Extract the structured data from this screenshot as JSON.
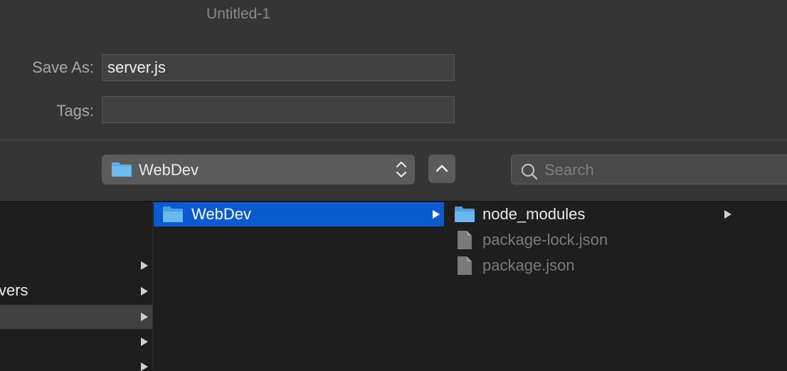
{
  "window": {
    "title": "Untitled-1"
  },
  "form": {
    "save_as_label": "Save As:",
    "save_as_value": "server.js",
    "tags_label": "Tags:",
    "tags_value": ""
  },
  "location": {
    "current_folder": "WebDev",
    "search_placeholder": "Search"
  },
  "columns": {
    "first": {
      "partial_item": "vers"
    },
    "second": {
      "selected_folder": "WebDev"
    },
    "third": [
      {
        "name": "node_modules",
        "type": "folder",
        "enabled": true
      },
      {
        "name": "package-lock.json",
        "type": "file",
        "enabled": false
      },
      {
        "name": "package.json",
        "type": "file",
        "enabled": false
      }
    ]
  },
  "colors": {
    "selection": "#0a5bd0",
    "folder": "#56a8e8",
    "background": "#1e1e1f",
    "panel": "#353535"
  },
  "icons": [
    "folder-icon",
    "file-icon",
    "search-icon",
    "chevron-up-icon",
    "updown-chevron-icon",
    "disclosure-arrow-icon"
  ]
}
